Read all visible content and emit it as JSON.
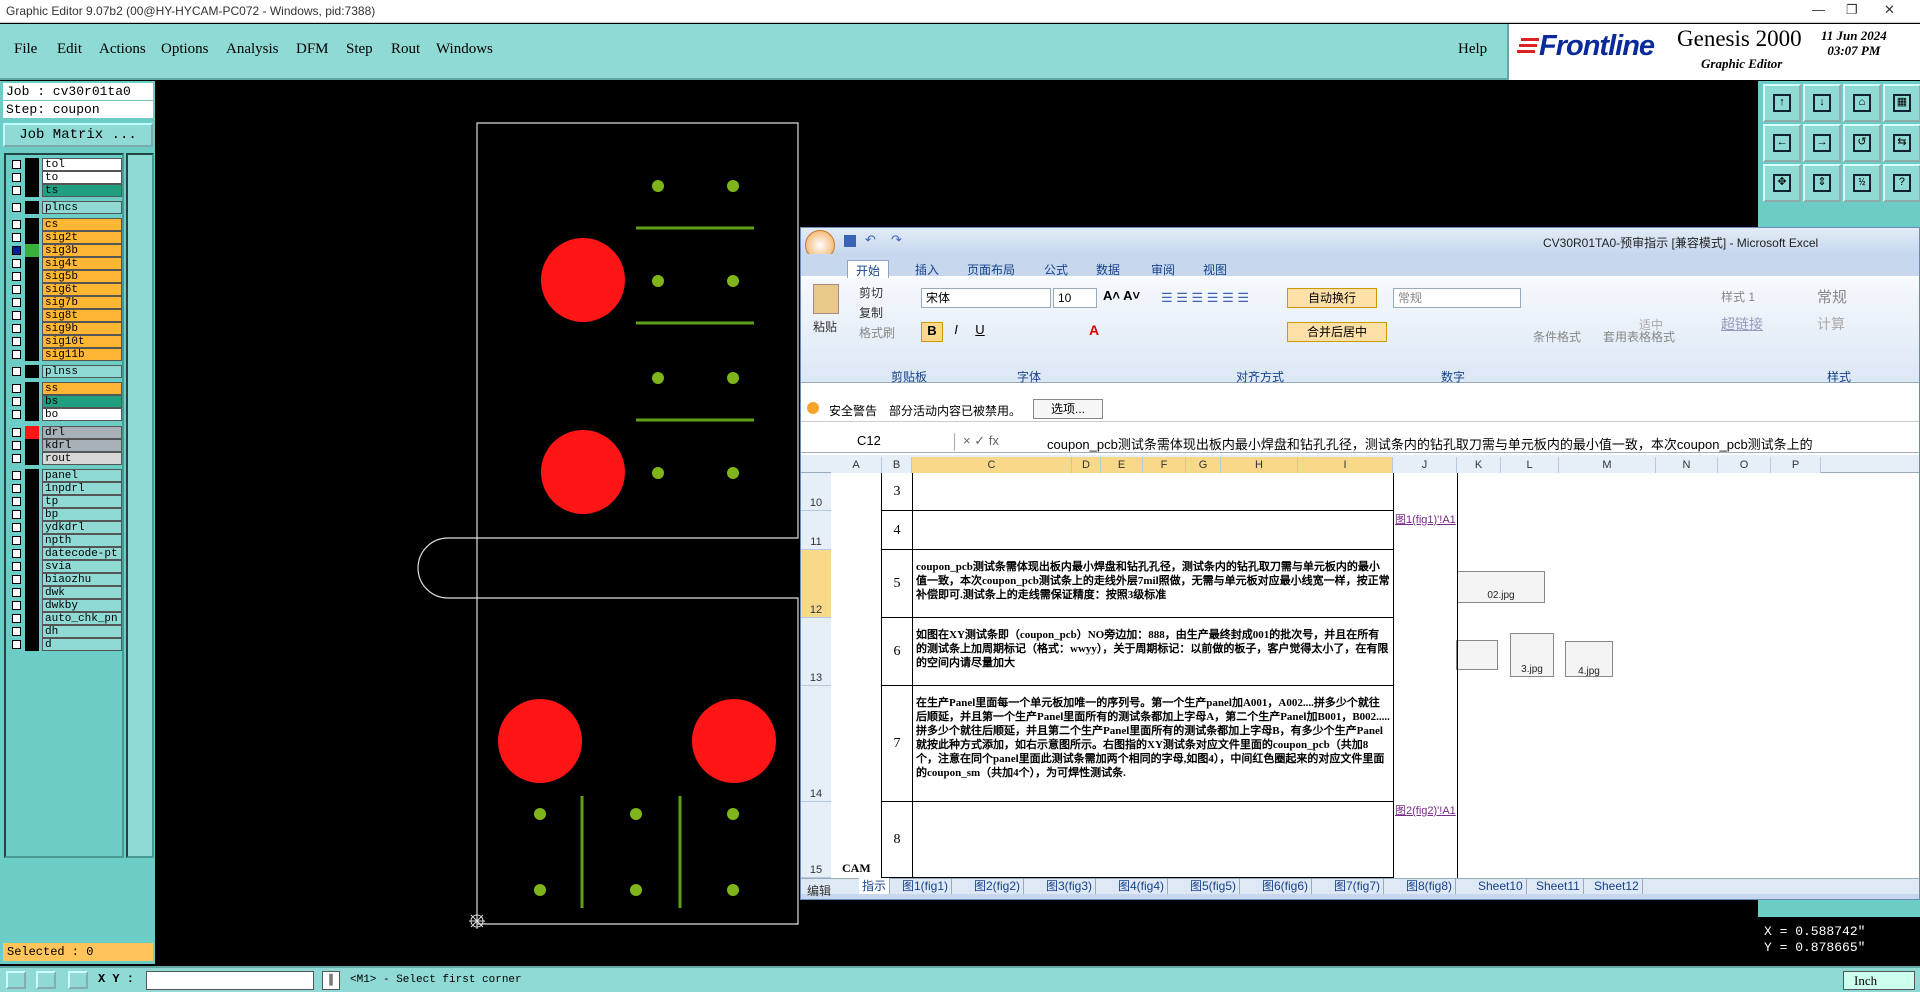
{
  "window": {
    "title": "Graphic Editor 9.07b2 (00@HY-HYCAM-PC072 - Windows, pid:7388)"
  },
  "menu": {
    "items": [
      "File",
      "Edit",
      "Actions",
      "Options",
      "Analysis",
      "DFM",
      "Step",
      "Rout",
      "Windows"
    ],
    "help": "Help"
  },
  "brand": {
    "name": "Frontline",
    "product": "Genesis 2000",
    "subtitle": "Graphic Editor",
    "date": "11 Jun 2024",
    "time": "03:07 PM"
  },
  "job": {
    "job_line": "Job : cv30r01ta0",
    "step_line": "Step: coupon",
    "matrix_button": "Job Matrix ..."
  },
  "layers": [
    {
      "name": "tol",
      "color": "#ffffff"
    },
    {
      "name": "to",
      "color": "#ffffff"
    },
    {
      "name": "ts",
      "color": "#20a080"
    },
    {
      "name": "plncs",
      "color": "#8fdad4"
    },
    {
      "name": "cs",
      "color": "#ffb733"
    },
    {
      "name": "sig2t",
      "color": "#ffb733"
    },
    {
      "name": "sig3b",
      "color": "#ffb733"
    },
    {
      "name": "sig4t",
      "color": "#ffb733"
    },
    {
      "name": "sig5b",
      "color": "#ffb733"
    },
    {
      "name": "sig6t",
      "color": "#ffb733"
    },
    {
      "name": "sig7b",
      "color": "#ffb733"
    },
    {
      "name": "sig8t",
      "color": "#ffb733"
    },
    {
      "name": "sig9b",
      "color": "#ffb733"
    },
    {
      "name": "sig10t",
      "color": "#ffb733"
    },
    {
      "name": "sig11b",
      "color": "#ffb733"
    },
    {
      "name": "plnss",
      "color": "#8fdad4"
    },
    {
      "name": "ss",
      "color": "#ffb733"
    },
    {
      "name": "bs",
      "color": "#20a080"
    },
    {
      "name": "bo",
      "color": "#ffffff"
    },
    {
      "name": "drl",
      "color": "#a8b0b8"
    },
    {
      "name": "kdrl",
      "color": "#a8b0b8"
    },
    {
      "name": "rout",
      "color": "#d8d8d8"
    },
    {
      "name": "panel",
      "color": "#8fdad4"
    },
    {
      "name": "1npdrl",
      "color": "#8fdad4"
    },
    {
      "name": "tp",
      "color": "#8fdad4"
    },
    {
      "name": "bp",
      "color": "#8fdad4"
    },
    {
      "name": "ydkdrl",
      "color": "#8fdad4"
    },
    {
      "name": "npth",
      "color": "#8fdad4"
    },
    {
      "name": "datecode-pt",
      "color": "#8fdad4"
    },
    {
      "name": "svia",
      "color": "#8fdad4"
    },
    {
      "name": "biaozhu",
      "color": "#8fdad4"
    },
    {
      "name": "dwk",
      "color": "#8fdad4"
    },
    {
      "name": "dwkby",
      "color": "#8fdad4"
    },
    {
      "name": "auto_chk_pn",
      "color": "#8fdad4"
    },
    {
      "name": "dh",
      "color": "#8fdad4"
    },
    {
      "name": "d",
      "color": "#8fdad4"
    }
  ],
  "status": {
    "selected": "Selected : 0",
    "xy_label": "X Y :",
    "prompt": "<M1> - Select first corner",
    "unit": "Inch",
    "x": "X = 0.588742\"",
    "y": "Y = 0.878665\""
  },
  "excel": {
    "title": "CV30R01TA0-预审指示 [兼容模式] - Microsoft Excel",
    "tabs": [
      "开始",
      "插入",
      "页面布局",
      "公式",
      "数据",
      "审阅",
      "视图"
    ],
    "clipboard": {
      "paste": "粘贴",
      "cut": "剪切",
      "copy": "复制",
      "format_painter": "格式刷",
      "group": "剪贴板"
    },
    "font": {
      "name": "宋体",
      "size": "10",
      "group": "字体"
    },
    "align": {
      "wrap": "自动换行",
      "merge": "合并后居中",
      "group": "对齐方式"
    },
    "number": {
      "format": "常规",
      "group": "数字"
    },
    "styles": {
      "cond": "条件格式",
      "table": "套用表格格式",
      "s1": "样式 1",
      "normal": "常规",
      "medium": "适中",
      "link": "超链接",
      "calc": "计算",
      "group": "样式"
    },
    "security": {
      "label": "安全警告",
      "msg": "部分活动内容已被禁用。",
      "button": "选项..."
    },
    "namebox": "C12",
    "formula": "coupon_pcb测试条需体现出板内最小焊盘和钻孔孔径，测试条内的钻孔取刀需与单元板内的最小值一致，本次coupon_pcb测试条上的",
    "columns": [
      "A",
      "B",
      "C",
      "D",
      "E",
      "F",
      "G",
      "H",
      "I",
      "J",
      "K",
      "L",
      "M",
      "N",
      "O",
      "P"
    ],
    "rows": [
      {
        "num": "10",
        "b": "3",
        "text": "",
        "link": ""
      },
      {
        "num": "11",
        "b": "4",
        "text": "",
        "link": "图1(fig1)'!A1"
      },
      {
        "num": "12",
        "b": "5",
        "text": "coupon_pcb测试条需体现出板内最小焊盘和钻孔孔径，测试条内的钻孔取刀需与单元板内的最小值一致，本次coupon_pcb测试条上的走线外层7mil照做，无需与单元板对应最小线宽一样，按正常补偿即可.测试条上的走线需保证精度：按照3级标准",
        "link": ""
      },
      {
        "num": "13",
        "b": "6",
        "text": "如图在XY测试条即（coupon_pcb）NO旁边加：888，由生产最终封成001的批次号，并且在所有的测试条上加周期标记（格式：wwyy），关于周期标记：以前做的板子，客户觉得太小了，在有限的空间内请尽量加大",
        "link": ""
      },
      {
        "num": "14",
        "b": "7",
        "text": "在生产Panel里面每一个单元板加唯一的序列号。第一个生产panel加A001，A002....拼多少个就往后顺延，并且第一个生产Panel里面所有的测试条都加上字母A，第二个生产Panel加B001，B002.....拼多少个就往后顺延，并且第二个生产Panel里面所有的测试条都加上字母B，有多少个生产Panel就按此种方式添加，如右示意图所示。右图指的XY测试条对应文件里面的coupon_pcb（共加8个，注意在同个panel里面此测试条需加两个相同的字母,如图4），中间红色圈起来的对应文件里面的coupon_sm（共加4个），为可焊性测试条.",
        "link": ""
      },
      {
        "num": "15",
        "b": "8",
        "text": "",
        "link": "图2(fig2)'!A1"
      }
    ],
    "a_label": "CAM指示",
    "images": [
      "02.jpg",
      "3.jpg",
      "4.jpg"
    ],
    "sheets": [
      "指示",
      "图1(fig1)",
      "图2(fig2)",
      "图3(fig3)",
      "图4(fig4)",
      "图5(fig5)",
      "图6(fig6)",
      "图7(fig7)",
      "图8(fig8)",
      "Sheet10",
      "Sheet11",
      "Sheet12"
    ],
    "mode": "编辑"
  }
}
